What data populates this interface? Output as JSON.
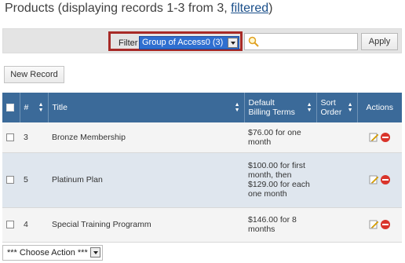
{
  "header": {
    "title_prefix": "Products (displaying records 1-3 from 3, ",
    "filtered_link": "filtered",
    "title_suffix": ")"
  },
  "filter": {
    "label": "Filter",
    "selected_value": "Group of Access0 (3)",
    "search_value": "",
    "apply_label": "Apply"
  },
  "toolbar": {
    "new_record_label": "New Record"
  },
  "table": {
    "columns": {
      "number": "#",
      "title": "Title",
      "billing_line1": "Default",
      "billing_line2": "Billing Terms",
      "sort_line1": "Sort",
      "sort_line2": "Order",
      "actions": "Actions"
    },
    "rows": [
      {
        "number": "3",
        "title": "Bronze Membership",
        "billing_lines": [
          "$76.00 for one",
          "month"
        ],
        "sort_order": ""
      },
      {
        "number": "5",
        "title": "Platinum Plan",
        "billing_lines": [
          "$100.00 for first",
          "month, then",
          "$129.00 for each",
          "one month"
        ],
        "sort_order": ""
      },
      {
        "number": "4",
        "title": "Special Training Programm",
        "billing_lines": [
          "$146.00 for 8",
          "months"
        ],
        "sort_order": ""
      }
    ]
  },
  "footer": {
    "choose_action_label": "*** Choose Action ***"
  },
  "colors": {
    "header_bg": "#3b6a99",
    "highlight_border": "#a72a27",
    "link": "#1a4f8a",
    "selected_filter": "#2f6fd0"
  }
}
